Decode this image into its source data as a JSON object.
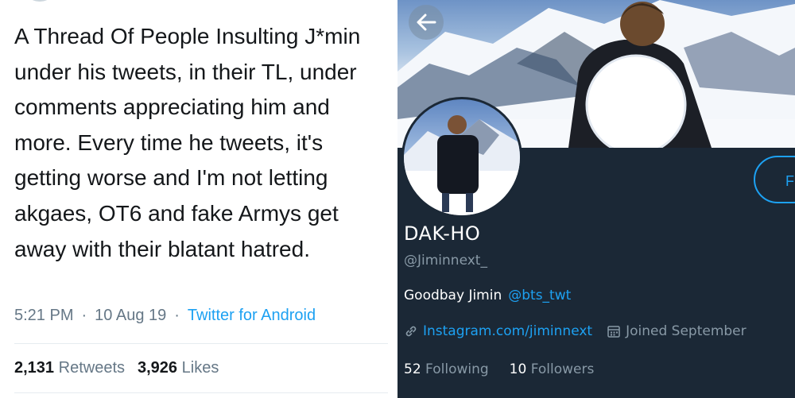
{
  "tweet": {
    "text": "A Thread Of People Insulting J*min under his tweets, in their TL, under comments appreciating him and more. Every time he tweets, it's getting worse and I'm not letting akgaes, OT6 and fake Armys get away with their blatant hatred.",
    "time": "5:21 PM",
    "date": "10 Aug 19",
    "source": "Twitter for Android",
    "retweets_count": "2,131",
    "retweets_label": "Retweets",
    "likes_count": "3,926",
    "likes_label": "Likes"
  },
  "profile": {
    "name": "DAK-HO",
    "handle": "@Jiminnext_",
    "bio_text": "Goodbay Jimin",
    "bio_mention": "@bts_twt",
    "website": "Instagram.com/jiminnext",
    "joined": "Joined September",
    "following_count": "52",
    "following_label": "Following",
    "followers_count": "10",
    "followers_label": "Followers",
    "follow_button_label": "F"
  },
  "icons": {
    "back": "back-arrow-icon",
    "link": "link-icon",
    "calendar": "calendar-icon"
  },
  "colors": {
    "twitter_blue": "#1da1f2",
    "dark_bg": "#1b2836",
    "muted_gray": "#657786"
  }
}
